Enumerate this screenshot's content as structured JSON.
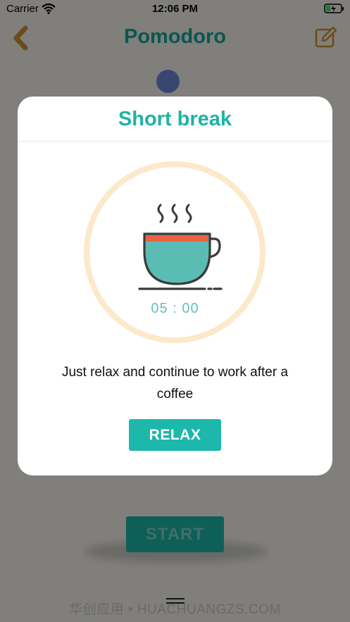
{
  "status_bar": {
    "carrier": "Carrier",
    "time": "12:06 PM"
  },
  "nav": {
    "title": "Pomodoro"
  },
  "main": {
    "start_label": "START"
  },
  "watermark": "华创应用 • HUACHUANGZS.COM",
  "modal": {
    "title": "Short break",
    "timer": "05 : 00",
    "message": "Just relax and continue to work after a coffee",
    "relax_label": "RELAX"
  },
  "icons": {
    "back": "chevron-left-icon",
    "edit": "edit-icon",
    "cup": "coffee-cup-icon"
  },
  "colors": {
    "brand_teal": "#1db7ac",
    "accent_gold": "#c9932f",
    "ring": "#fbe9c9",
    "cup_fill": "#5bbcb4",
    "cup_rim": "#ec6142"
  }
}
